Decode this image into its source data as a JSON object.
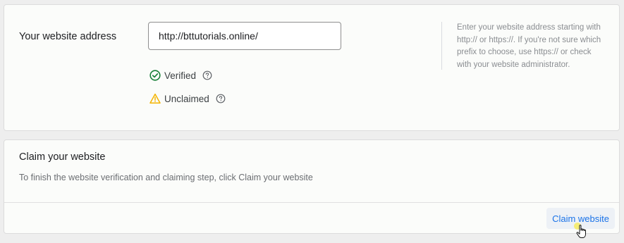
{
  "address_card": {
    "label": "Your website address",
    "url_value": "http://bttutorials.online/",
    "statuses": [
      {
        "text": "Verified",
        "icon": "check-circle-icon",
        "color": "#188038"
      },
      {
        "text": "Unclaimed",
        "icon": "warning-triangle-icon",
        "color": "#f4b400"
      }
    ],
    "help_text": "Enter your website address starting with http:// or https://. If you're not sure which prefix to choose, use https:// or check with your website administrator."
  },
  "claim_card": {
    "title": "Claim your website",
    "description": "To finish the website verification and claiming step, click Claim your website",
    "button_label": "Claim website"
  },
  "colors": {
    "accent": "#1a73e8",
    "verified": "#188038",
    "warning": "#f4b400",
    "card_bg": "#fbfcfa",
    "page_bg": "#eeeeee"
  }
}
